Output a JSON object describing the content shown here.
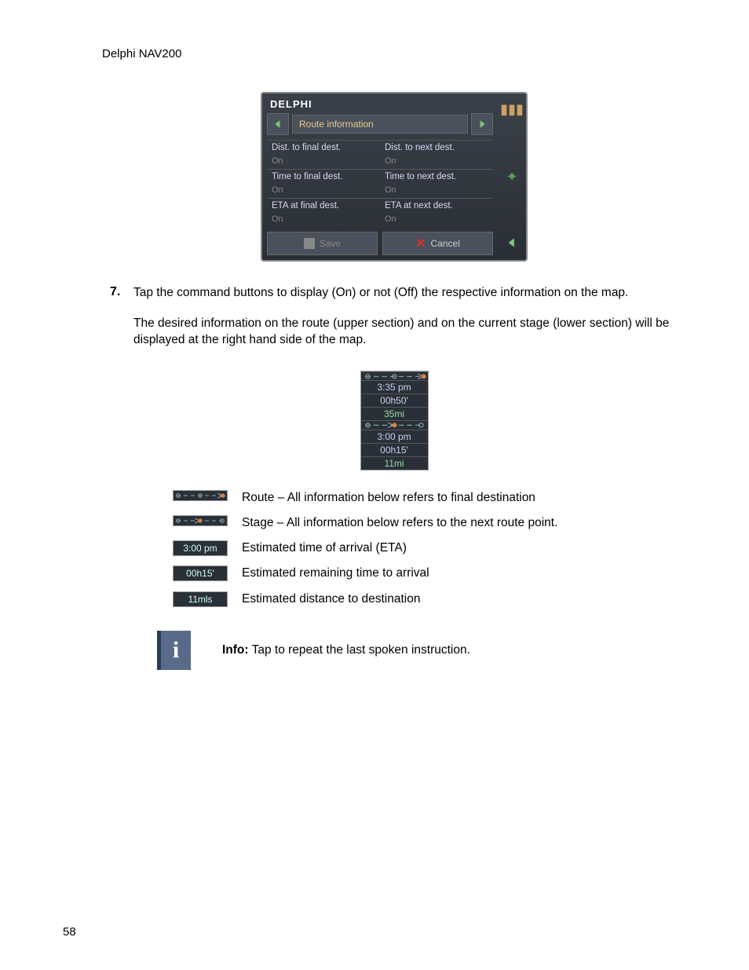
{
  "header": {
    "product": "Delphi NAV200"
  },
  "device": {
    "logo": "DELPHI",
    "title": "Route information",
    "labels": {
      "dist_final": "Dist. to final dest.",
      "dist_next": "Dist. to next dest.",
      "time_final": "Time to final dest.",
      "time_next": "Time to next dest.",
      "eta_final": "ETA at final dest.",
      "eta_next": "ETA at next dest."
    },
    "values": {
      "dist_final": "On",
      "dist_next": "On",
      "time_final": "On",
      "time_next": "On",
      "eta_final": "On",
      "eta_next": "On"
    },
    "buttons": {
      "save": "Save",
      "cancel": "Cancel"
    }
  },
  "step": {
    "num": "7.",
    "para1": "Tap the command buttons to display (On) or not (Off) the respective information on the map.",
    "para2": "The desired information on the route (upper section) and on the current stage (lower section) will be displayed at the right hand side of the map."
  },
  "infobox": {
    "rows": [
      "3:35 pm",
      "00h50'",
      "35mi",
      "3:00 pm",
      "00h15'",
      "11mi"
    ]
  },
  "legend": {
    "route": "Route – All information below refers to final destination",
    "stage": "Stage – All information below refers to the next route point.",
    "eta_box": "3:00 pm",
    "eta_text": "Estimated time of arrival (ETA)",
    "time_box": "00h15'",
    "time_text": "Estimated remaining time to arrival",
    "dist_box": "11mls",
    "dist_text": "Estimated distance to destination"
  },
  "info_note": {
    "label": "Info:",
    "text": " Tap to repeat the last spoken instruction."
  },
  "page_number": "58"
}
